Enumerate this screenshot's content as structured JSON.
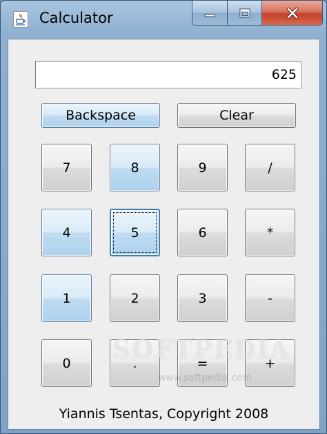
{
  "window": {
    "title": "Calculator"
  },
  "display": {
    "value": "625"
  },
  "buttons": {
    "backspace": "Backspace",
    "clear": "Clear",
    "rows": [
      [
        "7",
        "8",
        "9",
        "/"
      ],
      [
        "4",
        "5",
        "6",
        "*"
      ],
      [
        "1",
        "2",
        "3",
        "-"
      ],
      [
        "0",
        ".",
        "=",
        "+"
      ]
    ]
  },
  "footer": {
    "text": "Yiannis Tsentas, Copyright 2008"
  },
  "watermark": {
    "brand": "SOFTPEDIA",
    "url": "www.softpedia.com"
  },
  "icons": {
    "app": "java-coffee-cup-icon",
    "minimize": "minimize-icon",
    "maximize": "maximize-icon",
    "close": "close-icon"
  },
  "colors": {
    "titlebar": "#8fb0d1",
    "client_bg": "#eeeeee",
    "close_button": "#c4412b",
    "focus_ring": "#3c7fb1"
  }
}
